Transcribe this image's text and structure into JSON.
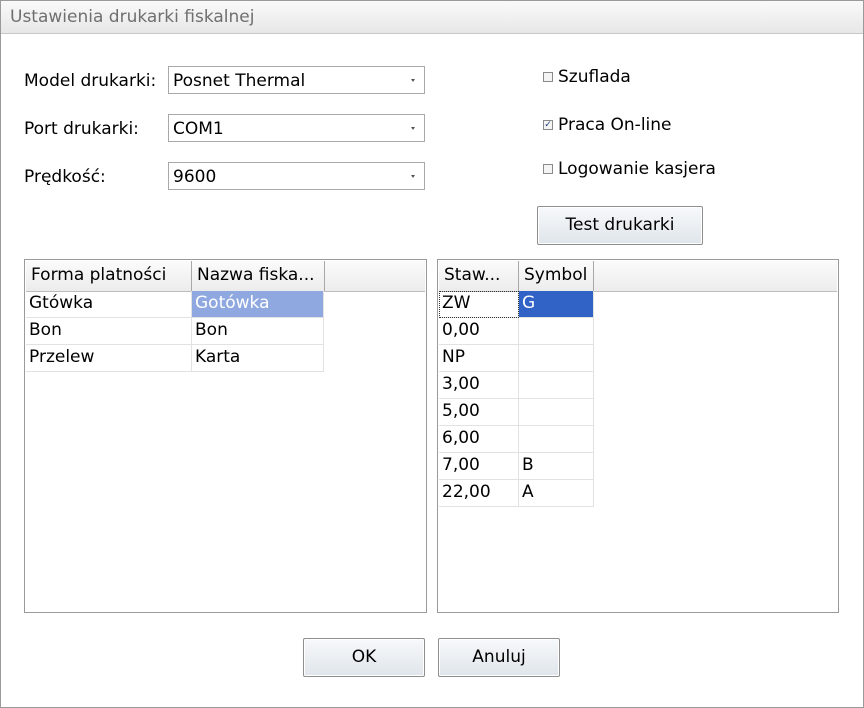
{
  "window": {
    "title": "Ustawienia drukarki fiskalnej"
  },
  "settings": {
    "model": {
      "label": "Model drukarki:",
      "value": "Posnet Thermal"
    },
    "port": {
      "label": "Port drukarki:",
      "value": "COM1"
    },
    "speed": {
      "label": "Prędkość:",
      "value": "9600"
    }
  },
  "options": {
    "drawer": {
      "label": "Szuflada",
      "checked": false
    },
    "online": {
      "label": "Praca On-line",
      "checked": true
    },
    "cashier_log": {
      "label": "Logowanie kasjera",
      "checked": false
    }
  },
  "test_button": "Test drukarki",
  "payments_table": {
    "headers": [
      "Forma platności",
      "Nazwa fiska..."
    ],
    "rows": [
      [
        "Gtówka",
        "Gotówka"
      ],
      [
        "Bon",
        "Bon"
      ],
      [
        "Przelew",
        "Karta"
      ]
    ]
  },
  "vat_table": {
    "headers": [
      "Staw...",
      "Symbol"
    ],
    "rows": [
      [
        "ZW",
        "G"
      ],
      [
        "0,00",
        ""
      ],
      [
        "NP",
        ""
      ],
      [
        "3,00",
        ""
      ],
      [
        "5,00",
        ""
      ],
      [
        "6,00",
        ""
      ],
      [
        "7,00",
        "B"
      ],
      [
        "22,00",
        "A"
      ]
    ]
  },
  "buttons": {
    "ok": "OK",
    "cancel": "Anuluj"
  }
}
